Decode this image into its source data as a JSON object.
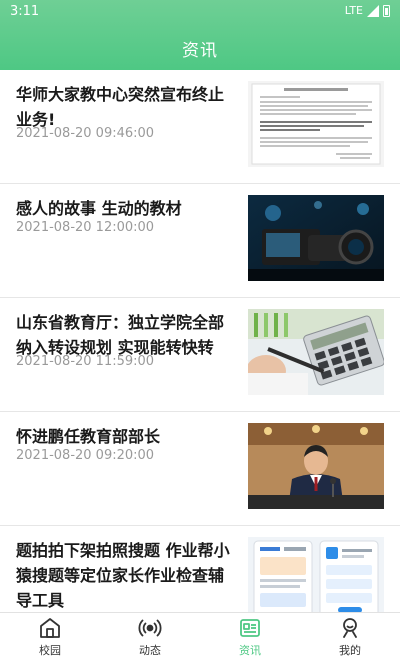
{
  "status_bar": {
    "time": "3:11",
    "network": "LTE"
  },
  "header": {
    "title": "资讯"
  },
  "articles": [
    {
      "title": "华师大家教中心突然宣布终止业务!",
      "date": "2021-08-20 09:46:00",
      "thumbnail": "document-scan-image"
    },
    {
      "title": "感人的故事 生动的教材",
      "date": "2021-08-20 12:00:00",
      "thumbnail": "video-camera-image"
    },
    {
      "title": "山东省教育厅：独立学院全部纳入转设规划 实现能转快转",
      "date": "2021-08-20 11:59:00",
      "thumbnail": "calculator-pen-image"
    },
    {
      "title": "怀进鹏任教育部部长",
      "date": "2021-08-20 09:20:00",
      "thumbnail": "press-conference-image"
    },
    {
      "title": "题拍拍下架拍照搜题 作业帮小猿搜题等定位家长作业检查辅导工具",
      "date": "",
      "thumbnail": "app-screenshot-image"
    }
  ],
  "tabbar": {
    "tabs": [
      {
        "label": "校园",
        "icon": "home-icon"
      },
      {
        "label": "动态",
        "icon": "broadcast-icon"
      },
      {
        "label": "资讯",
        "icon": "news-icon",
        "active": true
      },
      {
        "label": "我的",
        "icon": "profile-icon"
      }
    ]
  },
  "colors": {
    "accent": "#4ec884",
    "header_gradient_top": "#6fcf95"
  }
}
